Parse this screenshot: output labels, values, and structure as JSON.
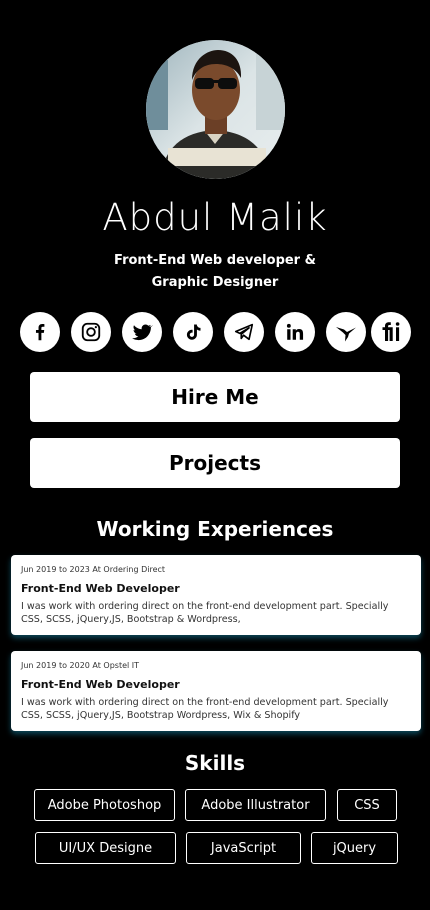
{
  "profile": {
    "name": "Abdul Malik",
    "subtitle_line1": "Front-End Web developer &",
    "subtitle_line2": "Graphic Designer"
  },
  "social": [
    {
      "icon": "facebook-icon"
    },
    {
      "icon": "instagram-icon"
    },
    {
      "icon": "twitter-icon"
    },
    {
      "icon": "tiktok-icon"
    },
    {
      "icon": "telegram-icon"
    },
    {
      "icon": "linkedin-icon"
    },
    {
      "icon": "hummingbird-icon"
    },
    {
      "icon": "fiverr-icon"
    }
  ],
  "buttons": {
    "hire": "Hire Me",
    "projects": "Projects"
  },
  "experience": {
    "title": "Working Experiences",
    "items": [
      {
        "meta": "Jun 2019 to 2023 At Ordering Direct",
        "role": "Front-End Web Developer",
        "desc_line1": "I was work with ordering direct on the front-end development part. Specially",
        "desc_line2": "CSS, SCSS, jQuery,JS, Bootstrap & Wordpress,"
      },
      {
        "meta": "Jun 2019 to 2020 At Opstel IT",
        "role": "Front-End Web Developer",
        "desc_line1": "I was work with ordering direct on the front-end development part. Specially",
        "desc_line2": "CSS, SCSS, jQuery,JS, Bootstrap Wordpress, Wix & Shopify"
      }
    ]
  },
  "skills": {
    "title": "Skills",
    "items": [
      "Adobe Photoshop",
      "Adobe Illustrator",
      "CSS",
      "UI/UX Designe",
      "JavaScript",
      "jQuery"
    ]
  },
  "colors": {
    "background": "#000000",
    "card": "#ffffff",
    "card_shadow": "#18a0c8"
  }
}
